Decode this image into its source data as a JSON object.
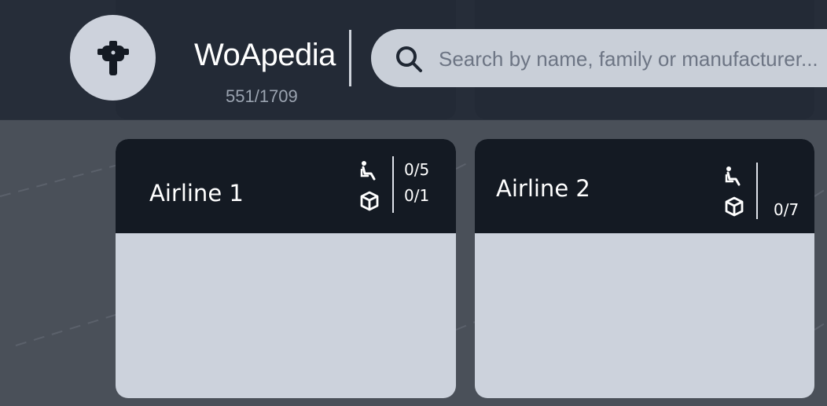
{
  "app": {
    "title": "WoApedia",
    "count": "551/1709"
  },
  "search": {
    "placeholder": "Search by name, family or manufacturer..."
  },
  "icons": {
    "logo": "airplane-icon",
    "search": "search-icon",
    "passenger": "passenger-seat-icon",
    "cargo": "cargo-box-icon"
  },
  "airlines": [
    {
      "name": "Airline 1",
      "passenger": "0/5",
      "cargo": "0/1"
    },
    {
      "name": "Airline 2",
      "cargo": "0/7"
    }
  ],
  "colors": {
    "header": "#1e2632",
    "card_header": "#141a23",
    "card_body": "#ccd2dc",
    "search_bg": "#c9cfd8"
  }
}
